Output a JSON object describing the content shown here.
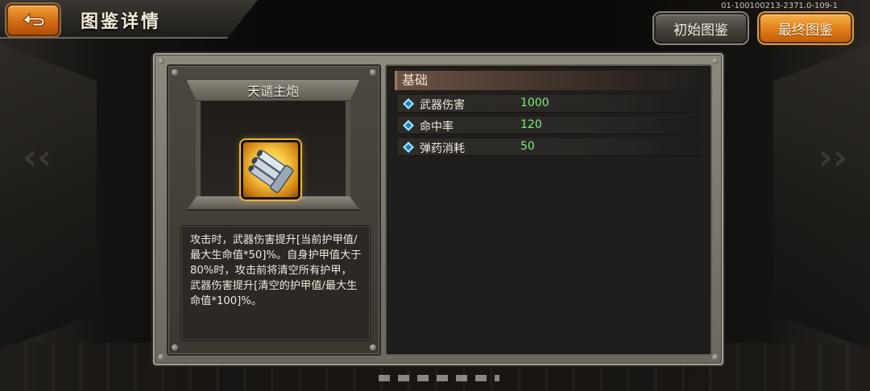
{
  "header": {
    "title": "图鉴详情",
    "version": "01-100100213-2371.0-109-1"
  },
  "tabs": {
    "initial_label": "初始图鉴",
    "final_label": "最终图鉴"
  },
  "item": {
    "name": "天谴主炮",
    "description": "攻击时，武器伤害提升[当前护甲值/最大生命值*50]%。自身护甲值大于80%时，攻击前将清空所有护甲，武器伤害提升[清空的护甲值/最大生命值*100]%。"
  },
  "stats": {
    "section_title": "基础",
    "rows": [
      {
        "label": "武器伤害",
        "value": "1000"
      },
      {
        "label": "命中率",
        "value": "120"
      },
      {
        "label": "弹药消耗",
        "value": "50"
      }
    ]
  },
  "colors": {
    "accent_orange": "#e07d17",
    "stat_value_green": "#7bf07a",
    "icon_gold": "#e8b43c"
  }
}
